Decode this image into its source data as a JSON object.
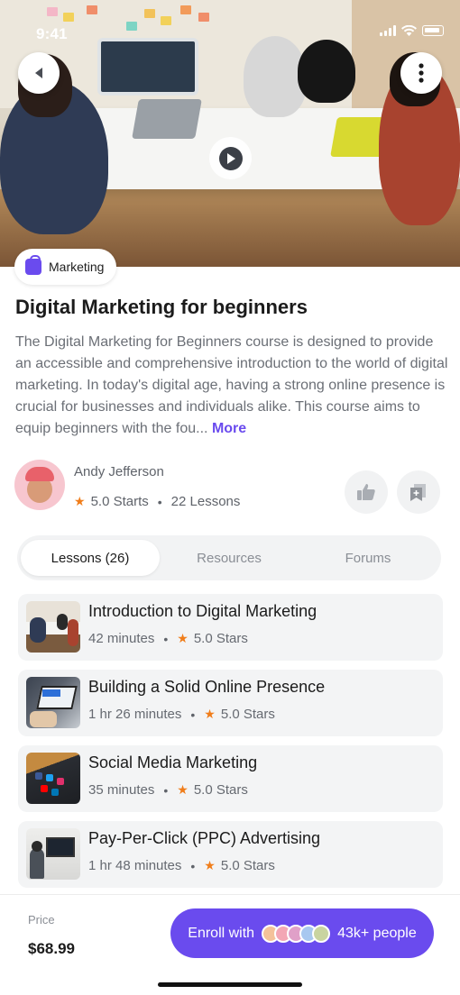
{
  "status_bar": {
    "time": "9:41"
  },
  "course": {
    "category": "Marketing",
    "title": "Digital Marketing for beginners",
    "description": "The Digital Marketing for Beginners course is designed to provide an accessible and comprehensive introduction to the world of digital marketing. In today's digital age, having a strong online presence is crucial for businesses and individuals alike. This course aims to equip beginners with the fou...",
    "more_label": "More"
  },
  "author": {
    "name": "Andy Jefferson",
    "rating": "5.0 Starts",
    "lessons": "22 Lessons"
  },
  "tabs": [
    {
      "label": "Lessons (26)",
      "active": true
    },
    {
      "label": "Resources",
      "active": false
    },
    {
      "label": "Forums",
      "active": false
    }
  ],
  "lessons": [
    {
      "title": "Introduction to Digital Marketing",
      "duration": "42 minutes",
      "rating": "5.0 Stars"
    },
    {
      "title": "Building a Solid Online Presence",
      "duration": "1 hr 26 minutes",
      "rating": "5.0 Stars"
    },
    {
      "title": "Social Media Marketing",
      "duration": "35 minutes",
      "rating": "5.0 Stars"
    },
    {
      "title": "Pay-Per-Click (PPC) Advertising",
      "duration": "1 hr 48 minutes",
      "rating": "5.0 Stars"
    }
  ],
  "footer": {
    "price_label": "Price",
    "price": "$68.99",
    "enroll_prefix": "Enroll with",
    "enroll_count": "43k+ people"
  },
  "colors": {
    "accent": "#6a4bee",
    "star": "#f07d1a"
  }
}
